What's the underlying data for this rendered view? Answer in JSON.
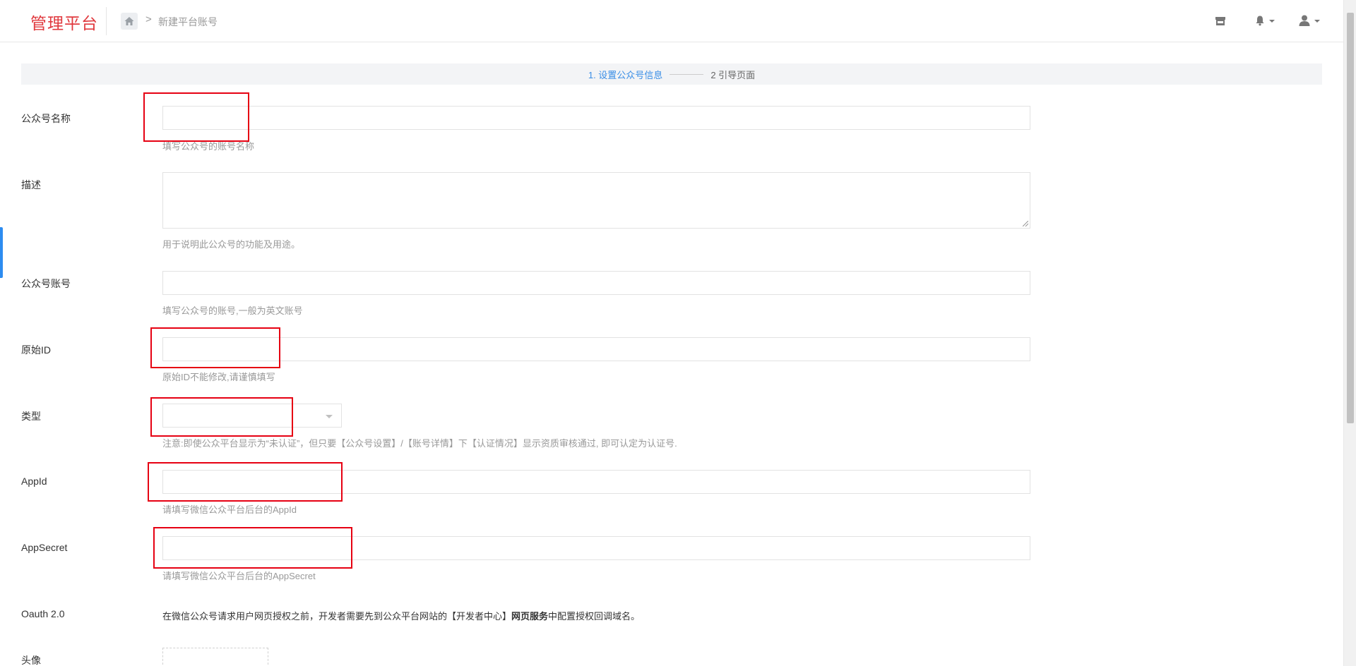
{
  "app": {
    "brand": "管理平台"
  },
  "breadcrumb": {
    "separator": ">",
    "current": "新建平台账号"
  },
  "steps": {
    "step1": "1. 设置公众号信息",
    "step2": "2 引导页面"
  },
  "form": {
    "name": {
      "label": "公众号名称",
      "value": "",
      "help": "填写公众号的账号名称"
    },
    "description": {
      "label": "描述",
      "value": "",
      "help": "用于说明此公众号的功能及用途。"
    },
    "account": {
      "label": "公众号账号",
      "value": "",
      "help": "填写公众号的账号,一般为英文账号"
    },
    "original_id": {
      "label": "原始ID",
      "value": "",
      "help": "原始ID不能修改,请谨慎填写"
    },
    "type": {
      "label": "类型",
      "selected": "",
      "help": "注意:即使公众平台显示为“未认证”，但只要【公众号设置】/【账号详情】下【认证情况】显示资质审核通过, 即可认定为认证号."
    },
    "appid": {
      "label": "AppId",
      "value": "",
      "help": "请填写微信公众平台后台的AppId"
    },
    "appsecret": {
      "label": "AppSecret",
      "value": "",
      "help": "请填写微信公众平台后台的AppSecret"
    },
    "oauth": {
      "label": "Oauth 2.0",
      "text_before": "在微信公众号请求用户网页授权之前，开发者需要先到公众平台网站的【开发者中心】",
      "text_bold": "网页服务",
      "text_after": "中配置授权回调域名。"
    },
    "avatar": {
      "label": "头像"
    }
  },
  "icons": {
    "home": "home-icon",
    "store": "store-icon",
    "bell": "bell-icon",
    "user": "user-icon"
  },
  "colors": {
    "brand": "#e0393e",
    "accent": "#3a8ee6",
    "highlight": "#e60012"
  }
}
